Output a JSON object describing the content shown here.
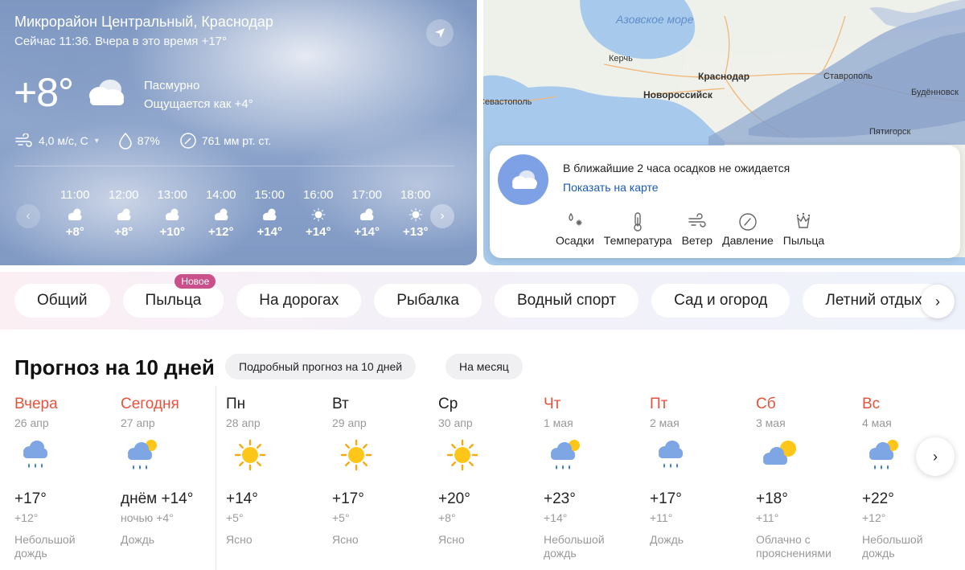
{
  "now": {
    "location": "Микрорайон Центральный, Краснодар",
    "subtitle": "Сейчас 11:36. Вчера в это время +17°",
    "temp": "+8°",
    "condition": "Пасмурно",
    "feels_like": "Ощущается как +4°",
    "wind": "4,0 м/с, С",
    "humidity": "87%",
    "pressure": "761 мм рт. ст."
  },
  "hourly": [
    {
      "time": "11:00",
      "icon": "partly-cloudy-icon",
      "temp": "+8°"
    },
    {
      "time": "12:00",
      "icon": "partly-cloudy-icon",
      "temp": "+8°"
    },
    {
      "time": "13:00",
      "icon": "partly-cloudy-icon",
      "temp": "+10°"
    },
    {
      "time": "14:00",
      "icon": "partly-cloudy-icon",
      "temp": "+12°"
    },
    {
      "time": "15:00",
      "icon": "partly-cloudy-icon",
      "temp": "+14°"
    },
    {
      "time": "16:00",
      "icon": "sun-icon",
      "temp": "+14°"
    },
    {
      "time": "17:00",
      "icon": "partly-cloudy-icon",
      "temp": "+14°"
    },
    {
      "time": "18:00",
      "icon": "sun-icon",
      "temp": "+13°"
    }
  ],
  "map": {
    "sea_label": "Азовское море",
    "cities": [
      "Керчь",
      "Краснодар",
      "Новороссийск",
      "Севастополь",
      "Ставрополь",
      "Будённовск",
      "Пятигорск"
    ],
    "precip_text": "В ближайшие 2 часа осадков не ожидается",
    "precip_link": "Показать на карте",
    "layers": [
      {
        "label": "Осадки",
        "icon": "precipitation-icon"
      },
      {
        "label": "Температура",
        "icon": "thermometer-icon"
      },
      {
        "label": "Ветер",
        "icon": "wind-icon"
      },
      {
        "label": "Давление",
        "icon": "pressure-icon"
      },
      {
        "label": "Пыльца",
        "icon": "pollen-icon"
      }
    ]
  },
  "tabs": [
    {
      "label": "Общий"
    },
    {
      "label": "Пыльца",
      "badge": "Новое"
    },
    {
      "label": "На дорогах"
    },
    {
      "label": "Рыбалка"
    },
    {
      "label": "Водный спорт"
    },
    {
      "label": "Сад и огород"
    },
    {
      "label": "Летний отдых"
    }
  ],
  "forecast": {
    "title": "Прогноз на 10 дней",
    "detailed_label": "Подробный прогноз на 10 дней",
    "month_label": "На месяц",
    "days": [
      {
        "name": "Вчера",
        "date": "26 апр",
        "red": true,
        "icon": "rain-cloud-icon",
        "hi": "+17°",
        "lo": "+12°",
        "cond": "Небольшой дождь"
      },
      {
        "name": "Сегодня",
        "date": "27 апр",
        "red": true,
        "icon": "rain-sun-cloud-icon",
        "hi": "днём +14°",
        "lo": "ночью +4°",
        "cond": "Дождь"
      },
      {
        "name": "Пн",
        "date": "28 апр",
        "red": false,
        "icon": "sun-icon",
        "hi": "+14°",
        "lo": "+5°",
        "cond": "Ясно"
      },
      {
        "name": "Вт",
        "date": "29 апр",
        "red": false,
        "icon": "sun-icon",
        "hi": "+17°",
        "lo": "+5°",
        "cond": "Ясно"
      },
      {
        "name": "Ср",
        "date": "30 апр",
        "red": false,
        "icon": "sun-icon",
        "hi": "+20°",
        "lo": "+8°",
        "cond": "Ясно"
      },
      {
        "name": "Чт",
        "date": "1 мая",
        "red": true,
        "icon": "rain-sun-cloud-icon",
        "hi": "+23°",
        "lo": "+14°",
        "cond": "Небольшой дождь"
      },
      {
        "name": "Пт",
        "date": "2 мая",
        "red": true,
        "icon": "rain-cloud-icon",
        "hi": "+17°",
        "lo": "+11°",
        "cond": "Дождь"
      },
      {
        "name": "Сб",
        "date": "3 мая",
        "red": true,
        "icon": "sun-cloud-icon",
        "hi": "+18°",
        "lo": "+11°",
        "cond": "Облачно с прояснениями"
      },
      {
        "name": "Вс",
        "date": "4 мая",
        "red": true,
        "icon": "rain-sun-cloud-icon",
        "hi": "+22°",
        "lo": "+12°",
        "cond": "Небольшой дождь"
      }
    ]
  }
}
